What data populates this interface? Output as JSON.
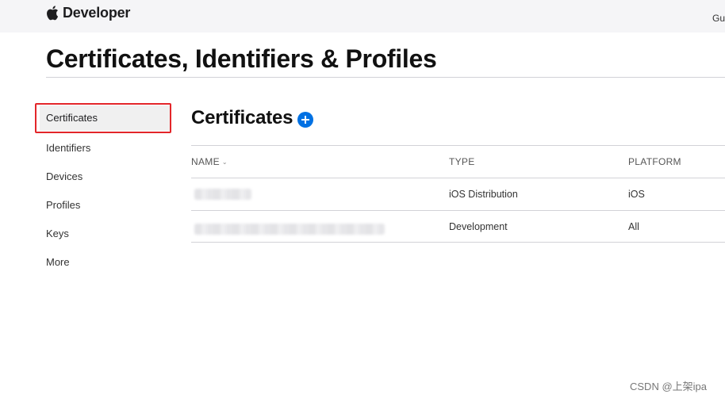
{
  "header": {
    "brand_text": "Developer",
    "logo_icon": "apple-logo-icon",
    "right_link": "Gu"
  },
  "page": {
    "title": "Certificates, Identifiers & Profiles"
  },
  "sidebar": {
    "items": [
      {
        "label": "Certificates",
        "active": true
      },
      {
        "label": "Identifiers"
      },
      {
        "label": "Devices"
      },
      {
        "label": "Profiles"
      },
      {
        "label": "Keys"
      },
      {
        "label": "More"
      }
    ]
  },
  "main": {
    "section_title": "Certificates",
    "add_icon": "plus-circle-icon",
    "accent_color": "#0071e3",
    "table": {
      "columns": [
        "NAME",
        "TYPE",
        "PLATFORM"
      ],
      "rows": [
        {
          "name": "",
          "type": "iOS Distribution",
          "platform": "iOS"
        },
        {
          "name": "",
          "type": "Development",
          "platform": "All"
        }
      ]
    }
  },
  "annotation": {
    "highlight_color": "#e3262a"
  },
  "watermark": "CSDN @上架ipa"
}
